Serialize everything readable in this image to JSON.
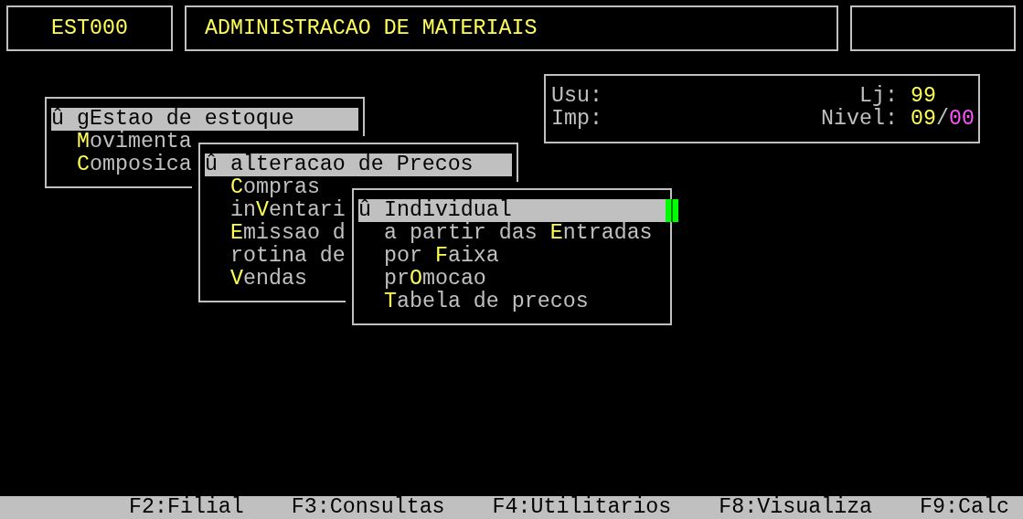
{
  "header": {
    "code": "EST000",
    "title": "ADMINISTRACAO DE MATERIAIS"
  },
  "info_box": {
    "rows": [
      {
        "left_label": "Usu:",
        "right_label": "Lj:",
        "right_value": [
          {
            "text": "99",
            "color": "#ffff55"
          }
        ]
      },
      {
        "left_label": "Imp:",
        "right_label": "Nivel:",
        "right_value": [
          {
            "text": "09",
            "color": "#ffff55"
          },
          {
            "text": "/",
            "color": "#c0c0c0"
          },
          {
            "text": "00",
            "color": "#ff55ff"
          }
        ]
      }
    ]
  },
  "menus": [
    {
      "items": [
        {
          "marker": "û",
          "pre": "g",
          "hotkey": "E",
          "post": "stao de estoque",
          "selected": true
        },
        {
          "hotkey": "M",
          "post": "ovimenta",
          "selected": false
        },
        {
          "hotkey": "C",
          "post": "omposica",
          "selected": false
        }
      ]
    },
    {
      "items": [
        {
          "marker": "û",
          "pre": "alteracao de ",
          "hotkey": "P",
          "post": "recos",
          "selected": true
        },
        {
          "hotkey": "C",
          "post": "ompras",
          "selected": false
        },
        {
          "pre": "in",
          "hotkey": "V",
          "post": "entari",
          "selected": false
        },
        {
          "hotkey": "E",
          "post": "missao d",
          "selected": false
        },
        {
          "pre": "rotina de",
          "selected": false
        },
        {
          "hotkey": "V",
          "post": "endas",
          "selected": false
        }
      ]
    },
    {
      "items": [
        {
          "marker": "û",
          "hotkey": "I",
          "post": "ndividual",
          "selected": true
        },
        {
          "pre": "a partir das ",
          "hotkey": "E",
          "post": "ntradas",
          "selected": false
        },
        {
          "pre": "por ",
          "hotkey": "F",
          "post": "aixa",
          "selected": false
        },
        {
          "pre": "pr",
          "hotkey": "O",
          "post": "mocao",
          "selected": false
        },
        {
          "hotkey": "T",
          "post": "abela de precos",
          "selected": false
        }
      ]
    }
  ],
  "function_keys": [
    "F2:Filial",
    "F3:Consultas",
    "F4:Utilitarios",
    "F8:Visualiza",
    "F9:Calc"
  ]
}
